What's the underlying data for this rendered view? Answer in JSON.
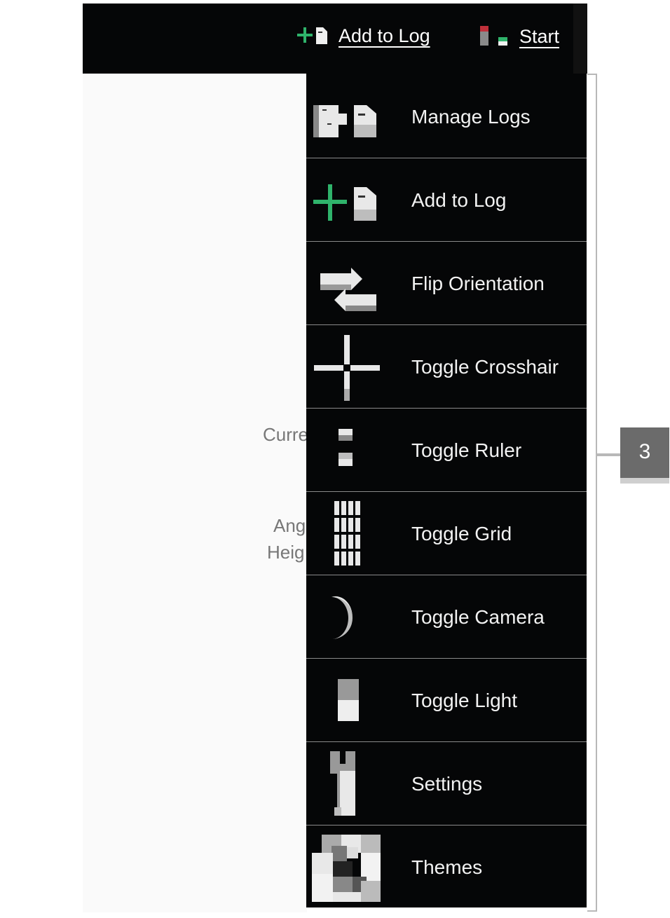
{
  "toolbar": {
    "add_to_log": "Add to Log",
    "start": "Start"
  },
  "background": {
    "labels": [
      "Curre",
      "Ang",
      "Heig"
    ]
  },
  "menu": {
    "items": [
      {
        "label": "Manage Logs",
        "icon": "manage-logs-icon"
      },
      {
        "label": "Add to Log",
        "icon": "add-to-log-icon"
      },
      {
        "label": "Flip Orientation",
        "icon": "flip-orientation-icon"
      },
      {
        "label": "Toggle Crosshair",
        "icon": "crosshair-icon"
      },
      {
        "label": "Toggle Ruler",
        "icon": "ruler-icon"
      },
      {
        "label": "Toggle Grid",
        "icon": "grid-icon"
      },
      {
        "label": "Toggle Camera",
        "icon": "camera-moon-icon"
      },
      {
        "label": "Toggle Light",
        "icon": "light-icon"
      },
      {
        "label": "Settings",
        "icon": "wrench-icon"
      },
      {
        "label": "Themes",
        "icon": "themes-icon"
      }
    ]
  },
  "callout": {
    "number": "3"
  },
  "colors": {
    "bar": "#050607",
    "accent_green": "#2fb36b",
    "accent_red": "#c0303a",
    "callout": "#6b6b6b"
  }
}
